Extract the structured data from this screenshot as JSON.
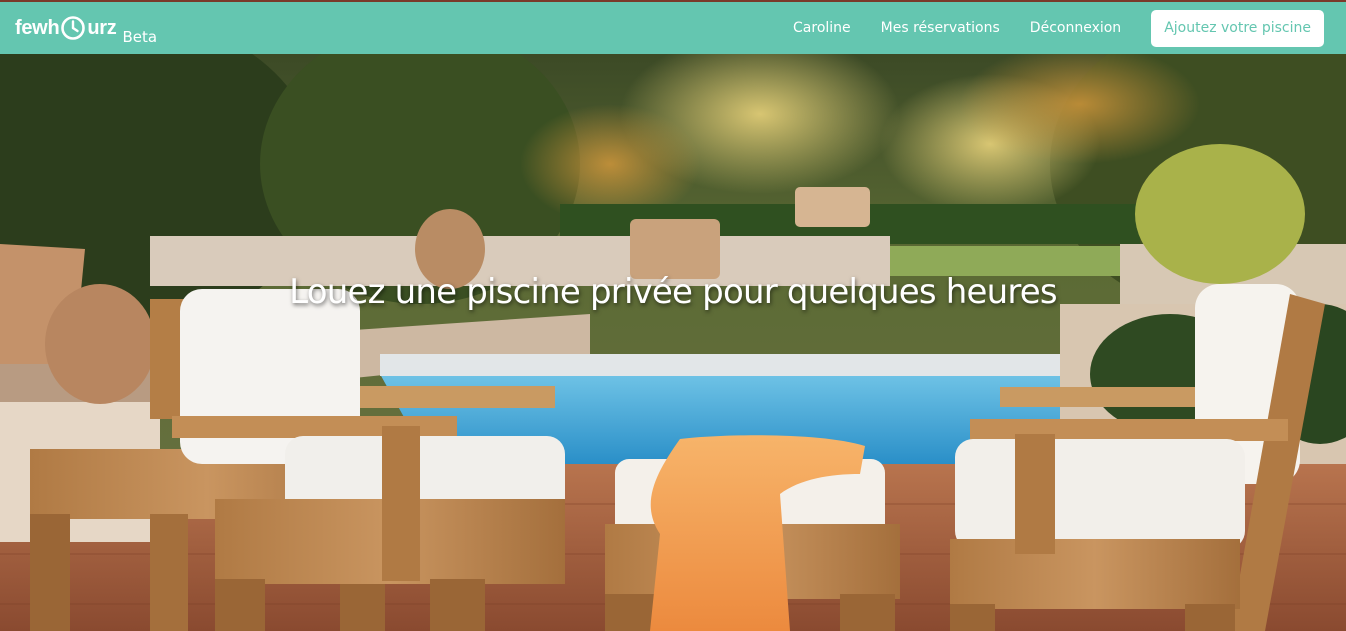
{
  "brand": {
    "name_part1": "fewh",
    "name_part2": "urz",
    "clock_icon": "clock-icon",
    "tag": "Beta"
  },
  "nav": {
    "user": "Caroline",
    "reservations": "Mes réservations",
    "logout": "Déconnexion",
    "cta": "Ajoutez votre piscine"
  },
  "hero": {
    "headline": "Louez une piscine privée pour quelques heures",
    "image": "pool-patio-photo"
  },
  "colors": {
    "navbar": "#64c6b0",
    "cta_text": "#64c6b0",
    "white": "#ffffff"
  }
}
